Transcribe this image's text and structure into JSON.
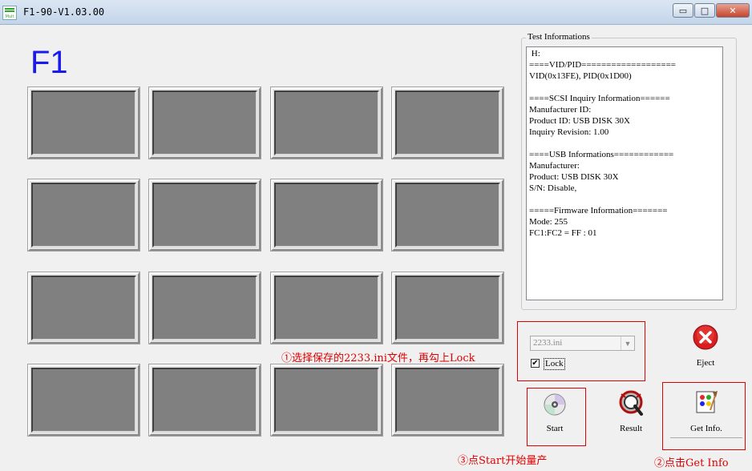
{
  "window": {
    "title": "F1-90-V1.03.00",
    "icon_text": "Mult",
    "minimize_glyph": "▭",
    "maximize_glyph": "□",
    "close_glyph": "✕"
  },
  "main": {
    "device_label": "F1"
  },
  "test_info": {
    "title": "Test Informations",
    "lines": [
      " H:",
      "====VID/PID===================",
      "VID(0x13FE), PID(0x1D00)",
      "",
      "====SCSI Inquiry Information======",
      "Manufacturer ID:",
      "Product ID: USB DISK 30X",
      "Inquiry Revision: 1.00",
      "",
      "====USB Informations============",
      "Manufacturer:",
      "Product: USB DISK 30X",
      "S/N: Disable,",
      "",
      "=====Firmware Information=======",
      "Mode: 255",
      "FC1:FC2 = FF : 01"
    ]
  },
  "config": {
    "selected_ini": "2233.ini",
    "lock_label": "Lock",
    "lock_checked": true,
    "checkmark": "✔"
  },
  "buttons": {
    "eject": "Eject",
    "start": "Start",
    "result": "Result",
    "get_info": "Get Info."
  },
  "annotations": {
    "step1": "①选择保存的2233.ini文件，再勾上Lock",
    "step2": "②点击Get Info",
    "step3": "③点Start开始量产"
  },
  "colors": {
    "annotation_red": "#e00000",
    "device_label_blue": "#1a1aef",
    "slot_gray": "#808080"
  }
}
